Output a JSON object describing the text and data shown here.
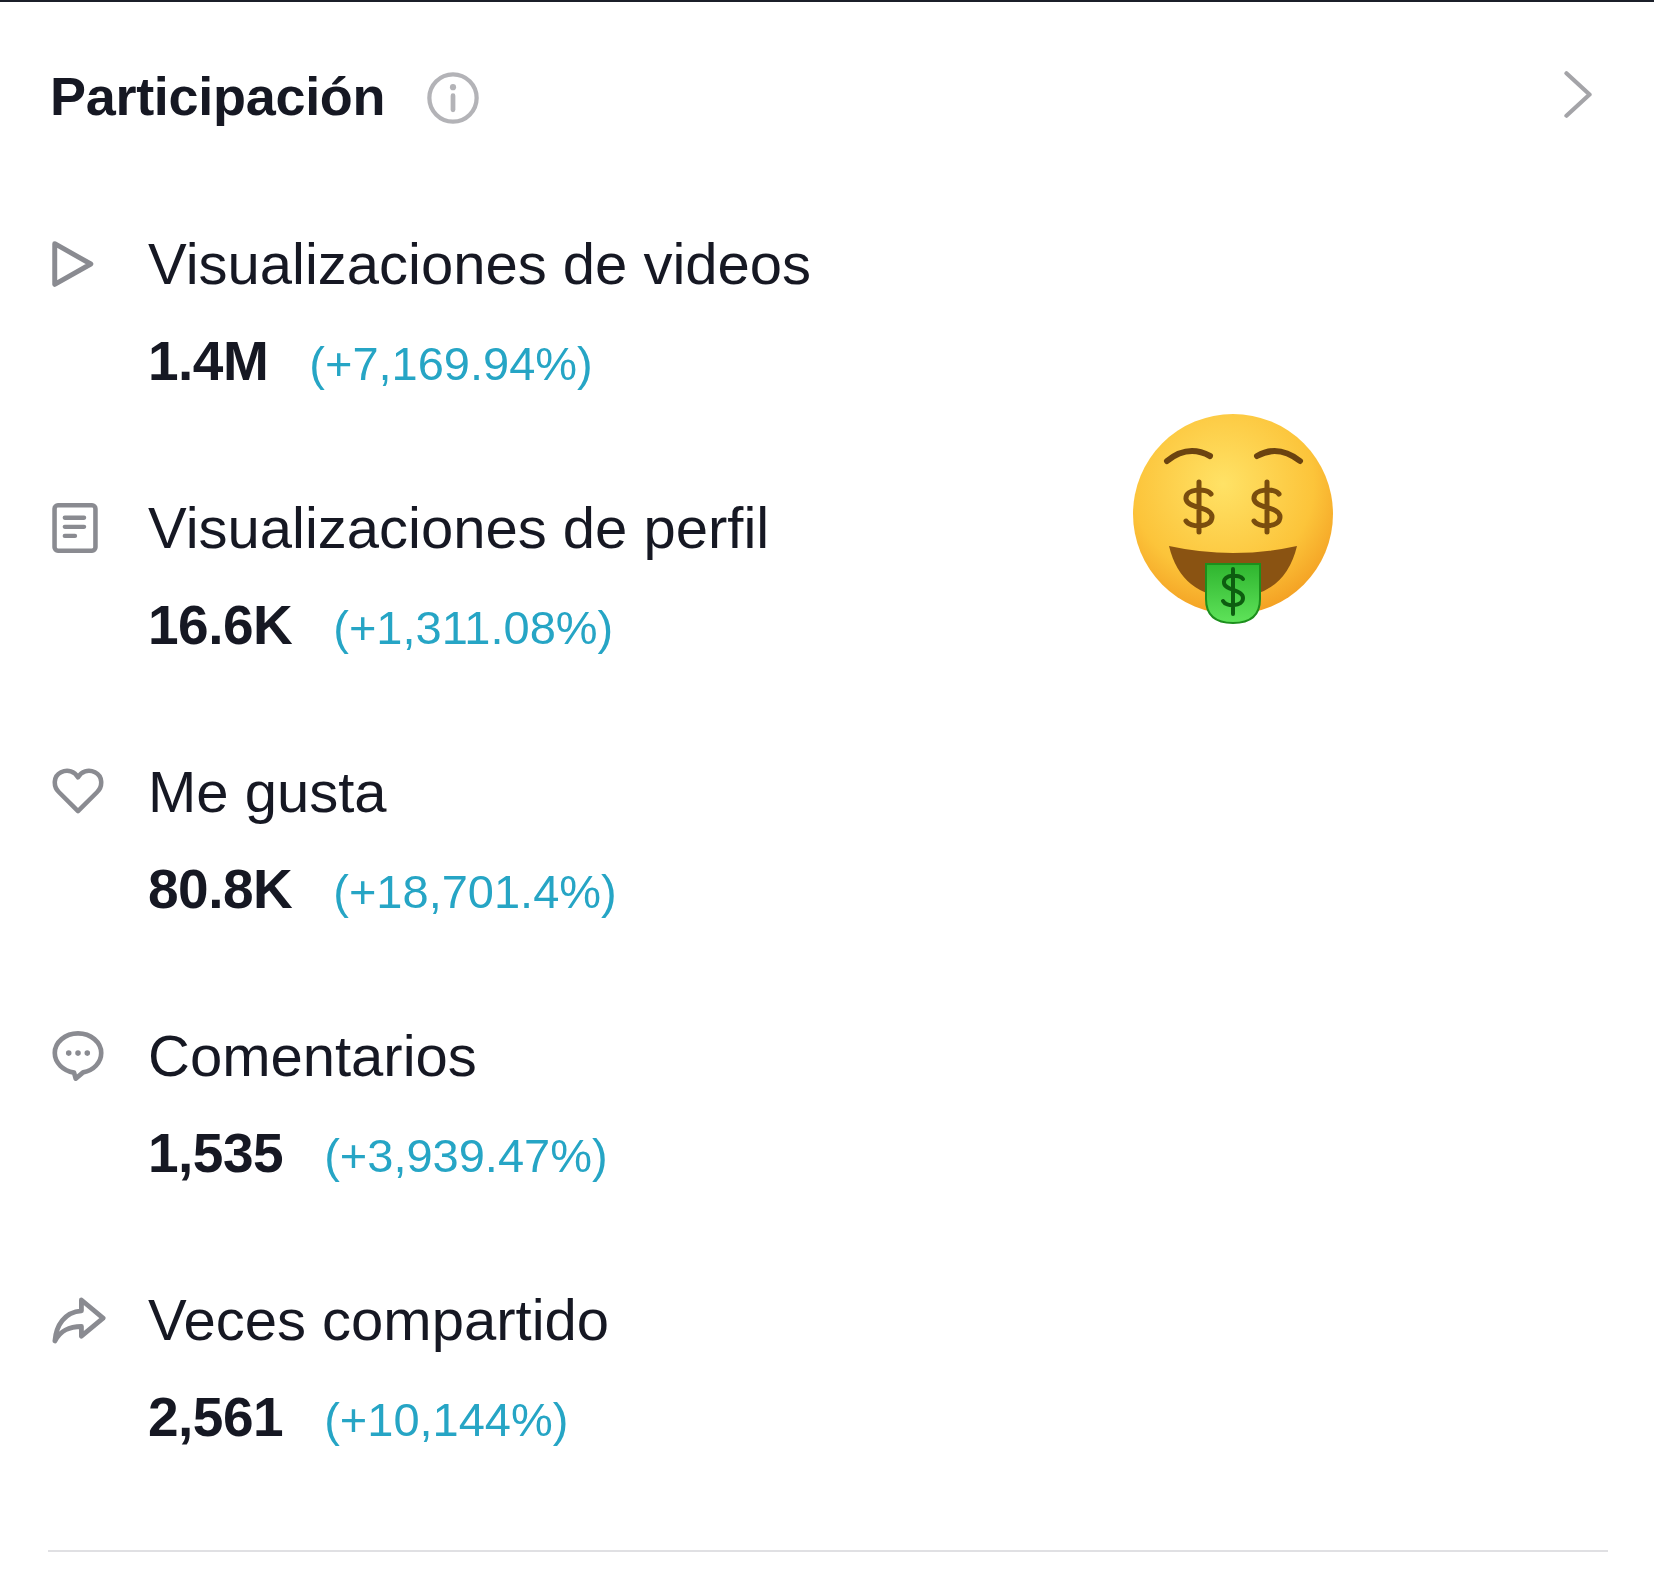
{
  "header": {
    "title": "Participación"
  },
  "metrics": [
    {
      "kind": "play",
      "label": "Visualizaciones de videos",
      "value": "1.4M",
      "change": "(+7,169.94%)"
    },
    {
      "kind": "profile",
      "label": "Visualizaciones de perfil",
      "value": "16.6K",
      "change": "(+1,311.08%)"
    },
    {
      "kind": "like",
      "label": "Me gusta",
      "value": "80.8K",
      "change": "(+18,701.4%)"
    },
    {
      "kind": "comment",
      "label": "Comentarios",
      "value": "1,535",
      "change": "(+3,939.47%)"
    },
    {
      "kind": "share",
      "label": "Veces compartido",
      "value": "2,561",
      "change": "(+10,144%)"
    }
  ]
}
